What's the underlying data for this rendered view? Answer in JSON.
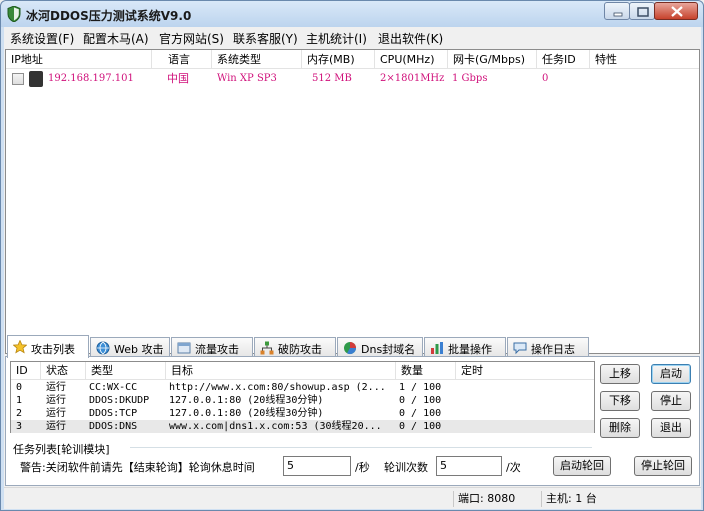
{
  "window": {
    "title": "冰河DDOS压力测试系统V9.0"
  },
  "menu": [
    "系统设置(F)",
    "配置木马(A)",
    "官方网站(S)",
    "联系客服(Y)",
    "主机统计(I)",
    "退出软件(K)"
  ],
  "host_list": {
    "columns": [
      "IP地址",
      "语言",
      "系统类型",
      "内存(MB)",
      "CPU(MHz)",
      "网卡(G/Mbps)",
      "任务ID",
      "特性"
    ],
    "rows": [
      {
        "ip": "192.168.197.101",
        "language": "中国",
        "os": "Win XP SP3",
        "memory": "512 MB",
        "cpu": "2×1801MHz",
        "nic": "1 Gbps",
        "task_id": "0",
        "feature": ""
      }
    ],
    "accent_color": "#d0117b"
  },
  "tabs": [
    "攻击列表",
    "Web 攻击",
    "流量攻击",
    "破防攻击",
    "Dns封域名",
    "批量操作",
    "操作日志"
  ],
  "task_list": {
    "columns": [
      "ID",
      "状态",
      "类型",
      "目标",
      "数量",
      "定时"
    ],
    "rows": [
      {
        "id": "0",
        "status": "运行",
        "type": "CC:WX-CC",
        "target": "http://www.x.com:80/showup.asp (2...",
        "count": "1 / 100",
        "timer": ""
      },
      {
        "id": "1",
        "status": "运行",
        "type": "DDOS:DKUDP",
        "target": "127.0.0.1:80 (20线程30分钟)",
        "count": "0 / 100",
        "timer": ""
      },
      {
        "id": "2",
        "status": "运行",
        "type": "DDOS:TCP",
        "target": "127.0.0.1:80 (20线程30分钟)",
        "count": "0 / 100",
        "timer": ""
      },
      {
        "id": "3",
        "status": "运行",
        "type": "DDOS:DNS",
        "target": "www.x.com|dns1.x.com:53 (30线程20...",
        "count": "0 / 100",
        "timer": ""
      }
    ]
  },
  "polling": {
    "group_caption": "任务列表[轮训模块]",
    "warning_label": "警告:关闭软件前请先【结束轮询】轮询休息时间",
    "rest_value": "5",
    "rest_unit": "/秒",
    "count_label": "轮训次数",
    "count_value": "5",
    "count_unit": "/次",
    "start_button": "启动轮回",
    "stop_button": "停止轮回"
  },
  "side_buttons": {
    "up": "上移",
    "start": "启动",
    "down": "下移",
    "stop": "停止",
    "delete": "删除",
    "exit": "退出"
  },
  "status_bar": {
    "port": "端口: 8080",
    "hosts": "主机: 1 台"
  }
}
